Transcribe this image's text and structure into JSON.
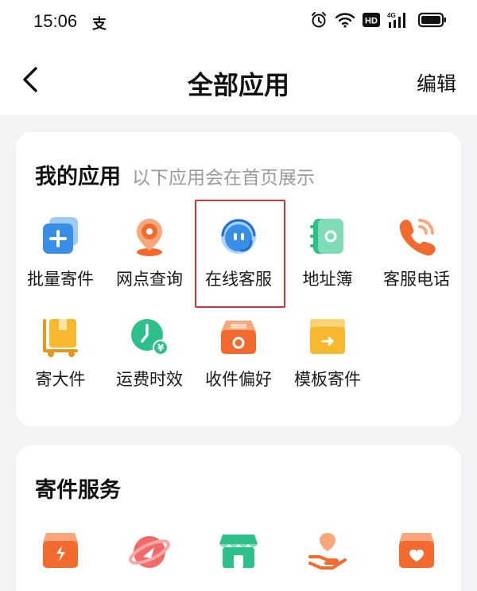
{
  "status_bar": {
    "time": "15:06",
    "pay_glyph": "支",
    "icons": [
      "alarm-icon",
      "wifi-icon",
      "hd-icon",
      "signal-4g-icon",
      "battery-icon"
    ],
    "hd_label": "HD",
    "network_label": "4G"
  },
  "nav": {
    "back_icon": "chevron-left-icon",
    "title": "全部应用",
    "edit_label": "编辑"
  },
  "my_apps": {
    "title": "我的应用",
    "subtitle": "以下应用会在首页展示",
    "highlighted": "在线客服",
    "highlight_color": "#e0302f",
    "items": [
      {
        "label": "批量寄件",
        "icon": "batch-send-icon"
      },
      {
        "label": "网点查询",
        "icon": "branch-location-icon"
      },
      {
        "label": "在线客服",
        "icon": "customer-service-icon"
      },
      {
        "label": "地址簿",
        "icon": "address-book-icon"
      },
      {
        "label": "客服电话",
        "icon": "phone-icon"
      },
      {
        "label": "寄大件",
        "icon": "large-package-icon"
      },
      {
        "label": "运费时效",
        "icon": "freight-timing-icon"
      },
      {
        "label": "收件偏好",
        "icon": "delivery-preference-icon"
      },
      {
        "label": "模板寄件",
        "icon": "template-send-icon"
      }
    ]
  },
  "send_services": {
    "title": "寄件服务",
    "items": [
      {
        "icon": "express-box-icon"
      },
      {
        "icon": "global-shipping-icon"
      },
      {
        "icon": "store-icon"
      },
      {
        "icon": "pickup-hand-icon"
      },
      {
        "icon": "gift-box-icon"
      }
    ]
  },
  "colors": {
    "orange": "#f26a2e",
    "blue": "#3a8ee6",
    "green": "#2ec08a",
    "yellow": "#f5b82e",
    "card_bg": "#ffffff",
    "page_bg": "#f3f3f5"
  }
}
